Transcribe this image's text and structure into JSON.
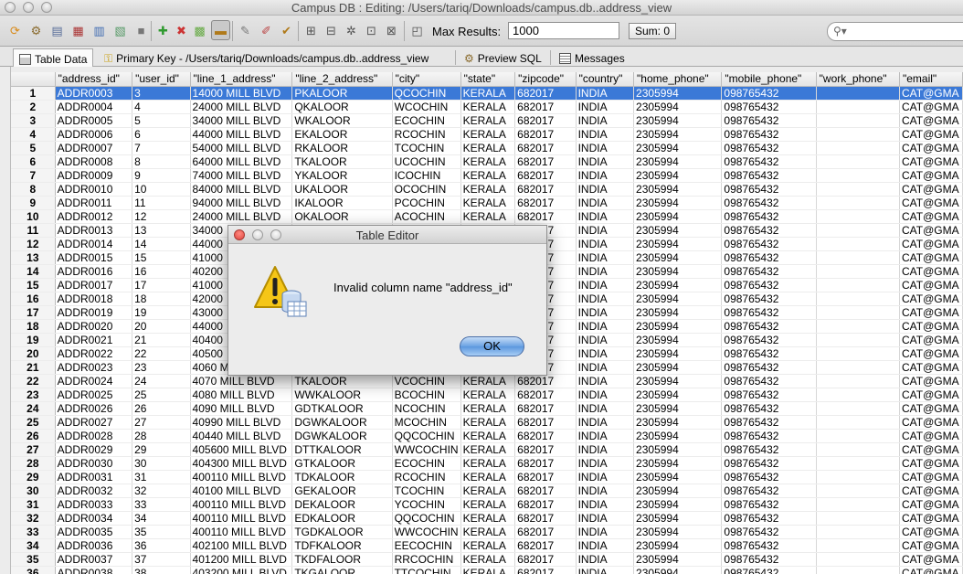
{
  "window": {
    "title": "Campus DB : Editing: /Users/tariq/Downloads/campus.db..address_view"
  },
  "toolbar": {
    "max_results_label": "Max Results:",
    "max_results_value": "1000",
    "sum_label": "Sum: 0",
    "search_placeholder": ""
  },
  "tabs": [
    {
      "label": "Table Data",
      "active": true
    },
    {
      "label": "Primary Key - /Users/tariq/Downloads/campus.db..address_view",
      "active": false
    },
    {
      "label": "Preview SQL",
      "active": false
    },
    {
      "label": "Messages",
      "active": false
    }
  ],
  "table": {
    "columns": [
      "\"address_id\"",
      "\"user_id\"",
      "\"line_1_address\"",
      "\"line_2_address\"",
      "\"city\"",
      "\"state\"",
      "\"zipcode\"",
      "\"country\"",
      "\"home_phone\"",
      "\"mobile_phone\"",
      "\"work_phone\"",
      "\"email\""
    ],
    "selected_row": 1,
    "rows": [
      [
        "1",
        "ADDR0003",
        "3",
        "14000 MILL BLVD",
        "PKALOOR",
        "QCOCHIN",
        "KERALA",
        "682017",
        "INDIA",
        "2305994",
        "098765432",
        "",
        "CAT@GMA"
      ],
      [
        "2",
        "ADDR0004",
        "4",
        "24000 MILL BLVD",
        "QKALOOR",
        "WCOCHIN",
        "KERALA",
        "682017",
        "INDIA",
        "2305994",
        "098765432",
        "",
        "CAT@GMA"
      ],
      [
        "3",
        "ADDR0005",
        "5",
        "34000 MILL BLVD",
        "WKALOOR",
        "ECOCHIN",
        "KERALA",
        "682017",
        "INDIA",
        "2305994",
        "098765432",
        "",
        "CAT@GMA"
      ],
      [
        "4",
        "ADDR0006",
        "6",
        "44000 MILL BLVD",
        "EKALOOR",
        "RCOCHIN",
        "KERALA",
        "682017",
        "INDIA",
        "2305994",
        "098765432",
        "",
        "CAT@GMA"
      ],
      [
        "5",
        "ADDR0007",
        "7",
        "54000 MILL BLVD",
        "RKALOOR",
        "TCOCHIN",
        "KERALA",
        "682017",
        "INDIA",
        "2305994",
        "098765432",
        "",
        "CAT@GMA"
      ],
      [
        "6",
        "ADDR0008",
        "8",
        "64000 MILL BLVD",
        "TKALOOR",
        "UCOCHIN",
        "KERALA",
        "682017",
        "INDIA",
        "2305994",
        "098765432",
        "",
        "CAT@GMA"
      ],
      [
        "7",
        "ADDR0009",
        "9",
        "74000 MILL BLVD",
        "YKALOOR",
        "ICOCHIN",
        "KERALA",
        "682017",
        "INDIA",
        "2305994",
        "098765432",
        "",
        "CAT@GMA"
      ],
      [
        "8",
        "ADDR0010",
        "10",
        "84000 MILL BLVD",
        "UKALOOR",
        "OCOCHIN",
        "KERALA",
        "682017",
        "INDIA",
        "2305994",
        "098765432",
        "",
        "CAT@GMA"
      ],
      [
        "9",
        "ADDR0011",
        "11",
        "94000 MILL BLVD",
        "IKALOOR",
        "PCOCHIN",
        "KERALA",
        "682017",
        "INDIA",
        "2305994",
        "098765432",
        "",
        "CAT@GMA"
      ],
      [
        "10",
        "ADDR0012",
        "12",
        "24000 MILL BLVD",
        "OKALOOR",
        "ACOCHIN",
        "KERALA",
        "682017",
        "INDIA",
        "2305994",
        "098765432",
        "",
        "CAT@GMA"
      ],
      [
        "11",
        "ADDR0013",
        "13",
        "34000",
        "",
        "",
        "",
        "682017",
        "INDIA",
        "2305994",
        "098765432",
        "",
        "CAT@GMA"
      ],
      [
        "12",
        "ADDR0014",
        "14",
        "44000",
        "",
        "",
        "",
        "682017",
        "INDIA",
        "2305994",
        "098765432",
        "",
        "CAT@GMA"
      ],
      [
        "13",
        "ADDR0015",
        "15",
        "41000",
        "",
        "",
        "",
        "682017",
        "INDIA",
        "2305994",
        "098765432",
        "",
        "CAT@GMA"
      ],
      [
        "14",
        "ADDR0016",
        "16",
        "40200",
        "",
        "",
        "",
        "682017",
        "INDIA",
        "2305994",
        "098765432",
        "",
        "CAT@GMA"
      ],
      [
        "15",
        "ADDR0017",
        "17",
        "41000",
        "",
        "",
        "",
        "682017",
        "INDIA",
        "2305994",
        "098765432",
        "",
        "CAT@GMA"
      ],
      [
        "16",
        "ADDR0018",
        "18",
        "42000",
        "",
        "",
        "",
        "682017",
        "INDIA",
        "2305994",
        "098765432",
        "",
        "CAT@GMA"
      ],
      [
        "17",
        "ADDR0019",
        "19",
        "43000",
        "",
        "",
        "",
        "682017",
        "INDIA",
        "2305994",
        "098765432",
        "",
        "CAT@GMA"
      ],
      [
        "18",
        "ADDR0020",
        "20",
        "44000",
        "",
        "",
        "",
        "682017",
        "INDIA",
        "2305994",
        "098765432",
        "",
        "CAT@GMA"
      ],
      [
        "19",
        "ADDR0021",
        "21",
        "40400",
        "",
        "",
        "",
        "682017",
        "INDIA",
        "2305994",
        "098765432",
        "",
        "CAT@GMA"
      ],
      [
        "20",
        "ADDR0022",
        "22",
        "40500",
        "",
        "",
        "",
        "682017",
        "INDIA",
        "2305994",
        "098765432",
        "",
        "CAT@GMA"
      ],
      [
        "21",
        "ADDR0023",
        "23",
        "4060 M",
        "",
        "",
        "",
        "682017",
        "INDIA",
        "2305994",
        "098765432",
        "",
        "CAT@GMA"
      ],
      [
        "22",
        "ADDR0024",
        "24",
        "4070 MILL BLVD",
        "TKALOOR",
        "VCOCHIN",
        "KERALA",
        "682017",
        "INDIA",
        "2305994",
        "098765432",
        "",
        "CAT@GMA"
      ],
      [
        "23",
        "ADDR0025",
        "25",
        "4080 MILL BLVD",
        "WWKALOOR",
        "BCOCHIN",
        "KERALA",
        "682017",
        "INDIA",
        "2305994",
        "098765432",
        "",
        "CAT@GMA"
      ],
      [
        "24",
        "ADDR0026",
        "26",
        "4090 MILL BLVD",
        "GDTKALOOR",
        "NCOCHIN",
        "KERALA",
        "682017",
        "INDIA",
        "2305994",
        "098765432",
        "",
        "CAT@GMA"
      ],
      [
        "25",
        "ADDR0027",
        "27",
        "40990 MILL BLVD",
        "DGWKALOOR",
        "MCOCHIN",
        "KERALA",
        "682017",
        "INDIA",
        "2305994",
        "098765432",
        "",
        "CAT@GMA"
      ],
      [
        "26",
        "ADDR0028",
        "28",
        "40440 MILL BLVD",
        "DGWKALOOR",
        "QQCOCHIN",
        "KERALA",
        "682017",
        "INDIA",
        "2305994",
        "098765432",
        "",
        "CAT@GMA"
      ],
      [
        "27",
        "ADDR0029",
        "29",
        "405600 MILL BLVD",
        "DTTKALOOR",
        "WWCOCHIN",
        "KERALA",
        "682017",
        "INDIA",
        "2305994",
        "098765432",
        "",
        "CAT@GMA"
      ],
      [
        "28",
        "ADDR0030",
        "30",
        "404300 MILL BLVD",
        "GTKALOOR",
        "ECOCHIN",
        "KERALA",
        "682017",
        "INDIA",
        "2305994",
        "098765432",
        "",
        "CAT@GMA"
      ],
      [
        "29",
        "ADDR0031",
        "31",
        "400110 MILL BLVD",
        "TDKALOOR",
        "RCOCHIN",
        "KERALA",
        "682017",
        "INDIA",
        "2305994",
        "098765432",
        "",
        "CAT@GMA"
      ],
      [
        "30",
        "ADDR0032",
        "32",
        "40100 MILL BLVD",
        "GEKALOOR",
        "TCOCHIN",
        "KERALA",
        "682017",
        "INDIA",
        "2305994",
        "098765432",
        "",
        "CAT@GMA"
      ],
      [
        "31",
        "ADDR0033",
        "33",
        "400110 MILL BLVD",
        "DEKALOOR",
        "YCOCHIN",
        "KERALA",
        "682017",
        "INDIA",
        "2305994",
        "098765432",
        "",
        "CAT@GMA"
      ],
      [
        "32",
        "ADDR0034",
        "34",
        "400110 MILL BLVD",
        "EDKALOOR",
        "QQCOCHIN",
        "KERALA",
        "682017",
        "INDIA",
        "2305994",
        "098765432",
        "",
        "CAT@GMA"
      ],
      [
        "33",
        "ADDR0035",
        "35",
        "400110 MILL BLVD",
        "TGDKALOOR",
        "WWCOCHIN",
        "KERALA",
        "682017",
        "INDIA",
        "2305994",
        "098765432",
        "",
        "CAT@GMA"
      ],
      [
        "34",
        "ADDR0036",
        "36",
        "402100 MILL BLVD",
        "TDFKALOOR",
        "EECOCHIN",
        "KERALA",
        "682017",
        "INDIA",
        "2305994",
        "098765432",
        "",
        "CAT@GMA"
      ],
      [
        "35",
        "ADDR0037",
        "37",
        "401200 MILL BLVD",
        "TKDFALOOR",
        "RRCOCHIN",
        "KERALA",
        "682017",
        "INDIA",
        "2305994",
        "098765432",
        "",
        "CAT@GMA"
      ],
      [
        "36",
        "ADDR0038",
        "38",
        "403200 MILL BLVD",
        "TKGALOOR",
        "TTCOCHIN",
        "KERALA",
        "682017",
        "INDIA",
        "2305994",
        "098765432",
        "",
        "CAT@GMA"
      ]
    ]
  },
  "dialog": {
    "title": "Table Editor",
    "message": "Invalid column name \"address_id\"",
    "ok_label": "OK"
  },
  "colors": {
    "selection": "#3b79d7",
    "close_light": "#e0443e",
    "min_light": "#dedede",
    "ok_button": "#6aa2e3"
  }
}
